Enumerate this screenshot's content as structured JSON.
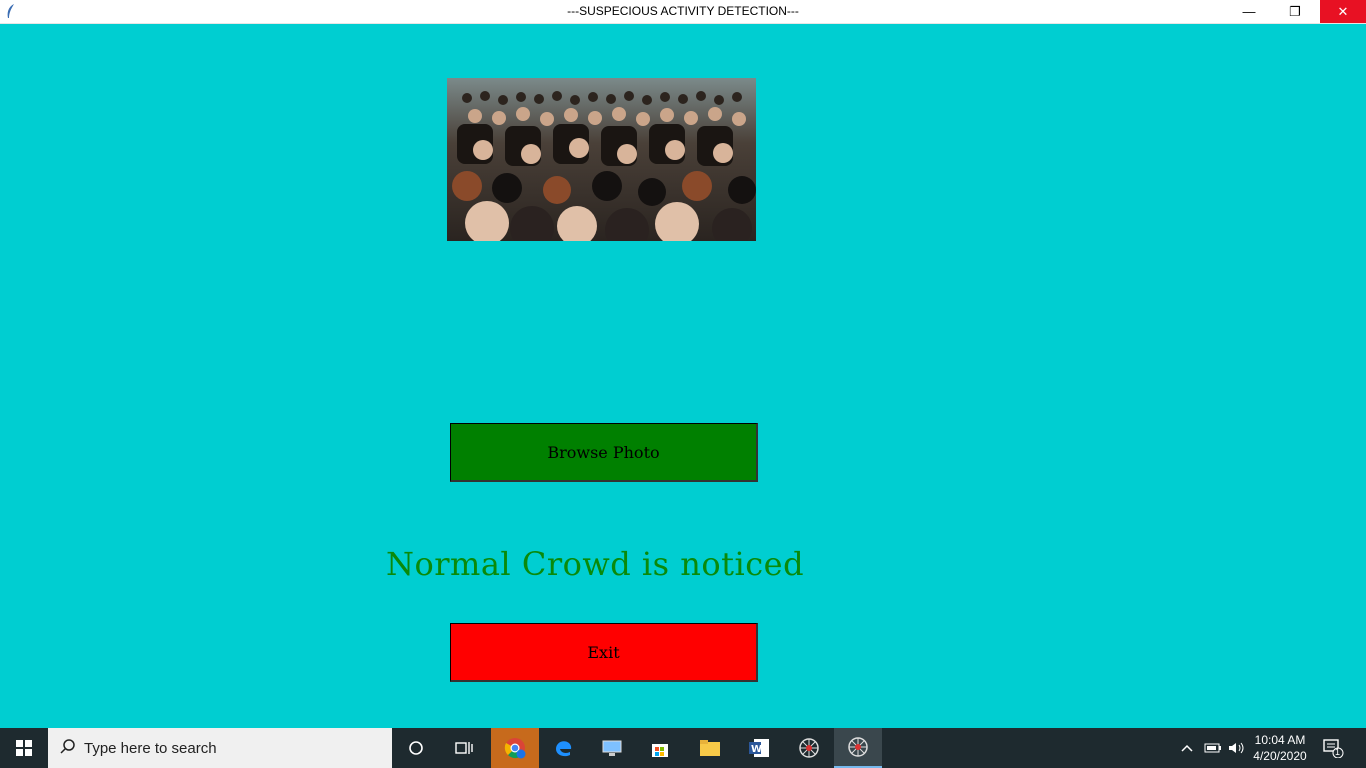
{
  "window": {
    "title": "---SUSPECIOUS ACTIVITY DETECTION---",
    "controls": {
      "minimize": "—",
      "maximize": "❐",
      "close": "✕"
    }
  },
  "main": {
    "image_alt": "crowd photo",
    "browse_label": "Browse Photo",
    "status_text": "Normal Crowd is noticed",
    "exit_label": "Exit"
  },
  "colors": {
    "background": "#00CED1",
    "browse_button": "#008000",
    "exit_button": "#FF0000",
    "status_text": "#0A8A0A"
  },
  "taskbar": {
    "search_placeholder": "Type here to search",
    "clock_time": "10:04 AM",
    "clock_date": "4/20/2020",
    "notification_count": "1",
    "icons": [
      "windows-icon",
      "cortana-icon",
      "task-view-icon",
      "chrome-icon",
      "edge-icon",
      "computer-icon",
      "store-icon",
      "file-explorer-icon",
      "word-icon",
      "app-icon",
      "app-icon"
    ]
  }
}
